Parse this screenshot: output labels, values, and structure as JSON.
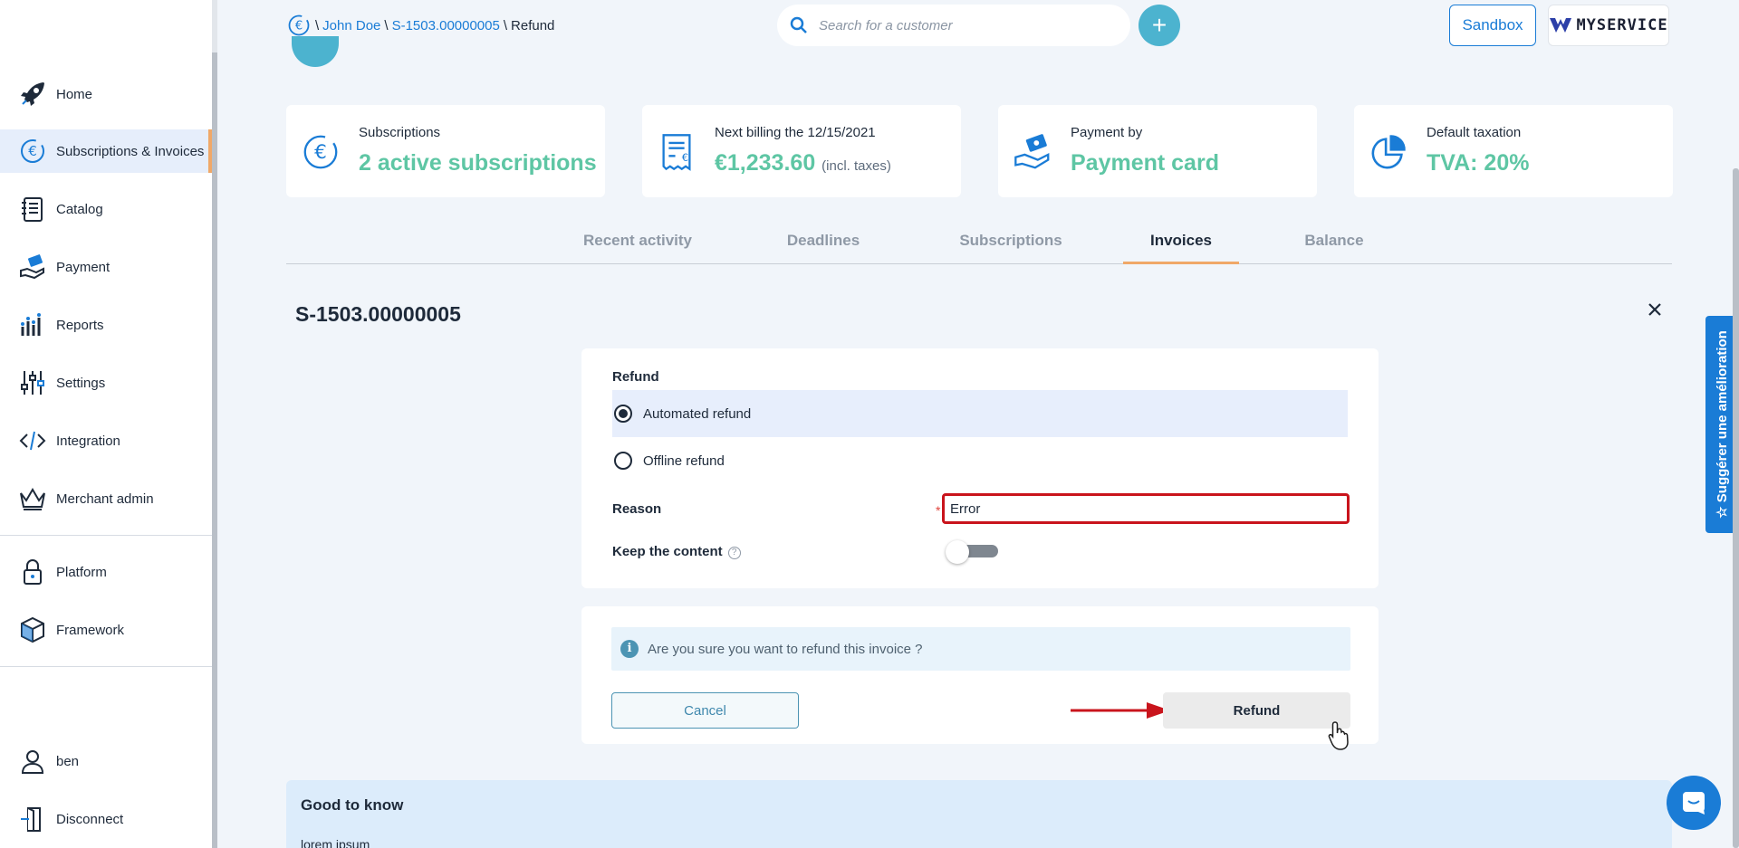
{
  "sidebar": {
    "items": [
      {
        "label": "Home",
        "icon": "rocket-icon"
      },
      {
        "label": "Subscriptions & Invoices",
        "icon": "euro-cycle-icon",
        "active": true
      },
      {
        "label": "Catalog",
        "icon": "notebook-icon"
      },
      {
        "label": "Payment",
        "icon": "hand-money-icon"
      },
      {
        "label": "Reports",
        "icon": "bar-chart-icon"
      },
      {
        "label": "Settings",
        "icon": "sliders-icon"
      },
      {
        "label": "Integration",
        "icon": "code-icon"
      },
      {
        "label": "Merchant admin",
        "icon": "crown-icon"
      },
      {
        "label": "Platform",
        "icon": "padlock-icon"
      },
      {
        "label": "Framework",
        "icon": "cube-icon"
      },
      {
        "label": "ben",
        "icon": "user-icon"
      },
      {
        "label": "Disconnect",
        "icon": "door-icon"
      }
    ]
  },
  "header": {
    "breadcrumb": {
      "sep": "\\",
      "customer": "John Doe",
      "subscription": "S-1503.00000005",
      "current": "Refund"
    },
    "search": {
      "placeholder": "Search for a customer",
      "value": ""
    },
    "add_label": "+",
    "sandbox_label": "Sandbox",
    "logo_text": "MYSERVICE"
  },
  "cards": [
    {
      "label": "Subscriptions",
      "value": "2 active subscriptions",
      "value_sub": "",
      "icon": "euro-cycle-icon"
    },
    {
      "label": "Next billing the 12/15/2021",
      "value": "€1,233.60",
      "value_sub": "(incl. taxes)",
      "icon": "receipt-icon"
    },
    {
      "label": "Payment by",
      "value": "Payment card",
      "value_sub": "",
      "icon": "hand-money-icon"
    },
    {
      "label": "Default taxation",
      "value": "TVA: 20%",
      "value_sub": "",
      "icon": "pie-chart-icon"
    }
  ],
  "tabs": [
    {
      "label": "Recent activity"
    },
    {
      "label": "Deadlines"
    },
    {
      "label": "Subscriptions"
    },
    {
      "label": "Invoices",
      "active": true
    },
    {
      "label": "Balance"
    }
  ],
  "page_title": "S-1503.00000005",
  "refund_form": {
    "section_label": "Refund",
    "options": [
      {
        "label": "Automated refund",
        "selected": true
      },
      {
        "label": "Offline refund",
        "selected": false
      }
    ],
    "reason_label": "Reason",
    "required_mark": "*",
    "reason_value": "Error",
    "keep_content_label": "Keep the content",
    "help_mark": "?",
    "keep_content_on": false
  },
  "confirm": {
    "info_mark": "i",
    "message": "Are you sure you want to refund this invoice ?",
    "cancel_label": "Cancel",
    "refund_label": "Refund"
  },
  "good_to_know": {
    "title": "Good to know",
    "body": "lorem ipsum"
  },
  "feedback_label": "Suggérer une amélioration",
  "colors": {
    "brand_blue": "#1a7cd6",
    "accent_green": "#5ec6a4",
    "accent_orange": "#f0a868",
    "error_red": "#c9141c"
  }
}
